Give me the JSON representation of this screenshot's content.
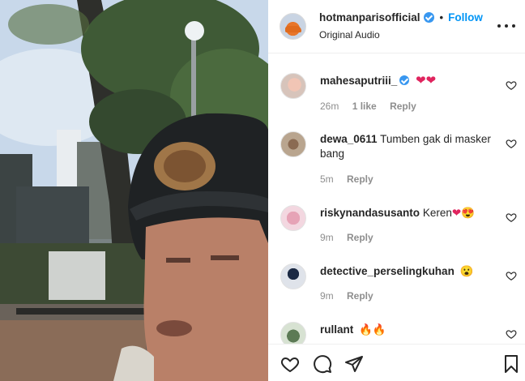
{
  "post": {
    "username": "hotmanparisofficial",
    "follow_label": "Follow",
    "separator": "•",
    "audio_label": "Original Audio"
  },
  "comments": [
    {
      "username": "mahesaputriii_",
      "verified": true,
      "text": "",
      "emoji": "❤❤",
      "time": "26m",
      "likes": "1 like",
      "reply_label": "Reply"
    },
    {
      "username": "dewa_0611",
      "verified": false,
      "text": "Tumben gak di masker bang",
      "emoji": "",
      "time": "5m",
      "likes": "",
      "reply_label": "Reply"
    },
    {
      "username": "riskynandasusanto",
      "verified": false,
      "text": "Keren",
      "emoji": "❤😍",
      "time": "9m",
      "likes": "",
      "reply_label": "Reply"
    },
    {
      "username": "detective_perselingkuhan",
      "verified": false,
      "text": "",
      "emoji": "😮",
      "time": "9m",
      "likes": "",
      "reply_label": "Reply"
    },
    {
      "username": "rullant",
      "verified": false,
      "text": "",
      "emoji": "🔥🔥",
      "time": "",
      "likes": "",
      "reply_label": ""
    }
  ],
  "icons": {
    "like": "heart-icon",
    "comment": "comment-icon",
    "share": "share-icon",
    "save": "bookmark-icon",
    "more": "more-options-icon"
  },
  "colors": {
    "accent": "#0095f6",
    "verified": "#3897f0",
    "text": "#262626",
    "muted": "#8e8e8e",
    "heart_emoji": "#e0245e"
  }
}
